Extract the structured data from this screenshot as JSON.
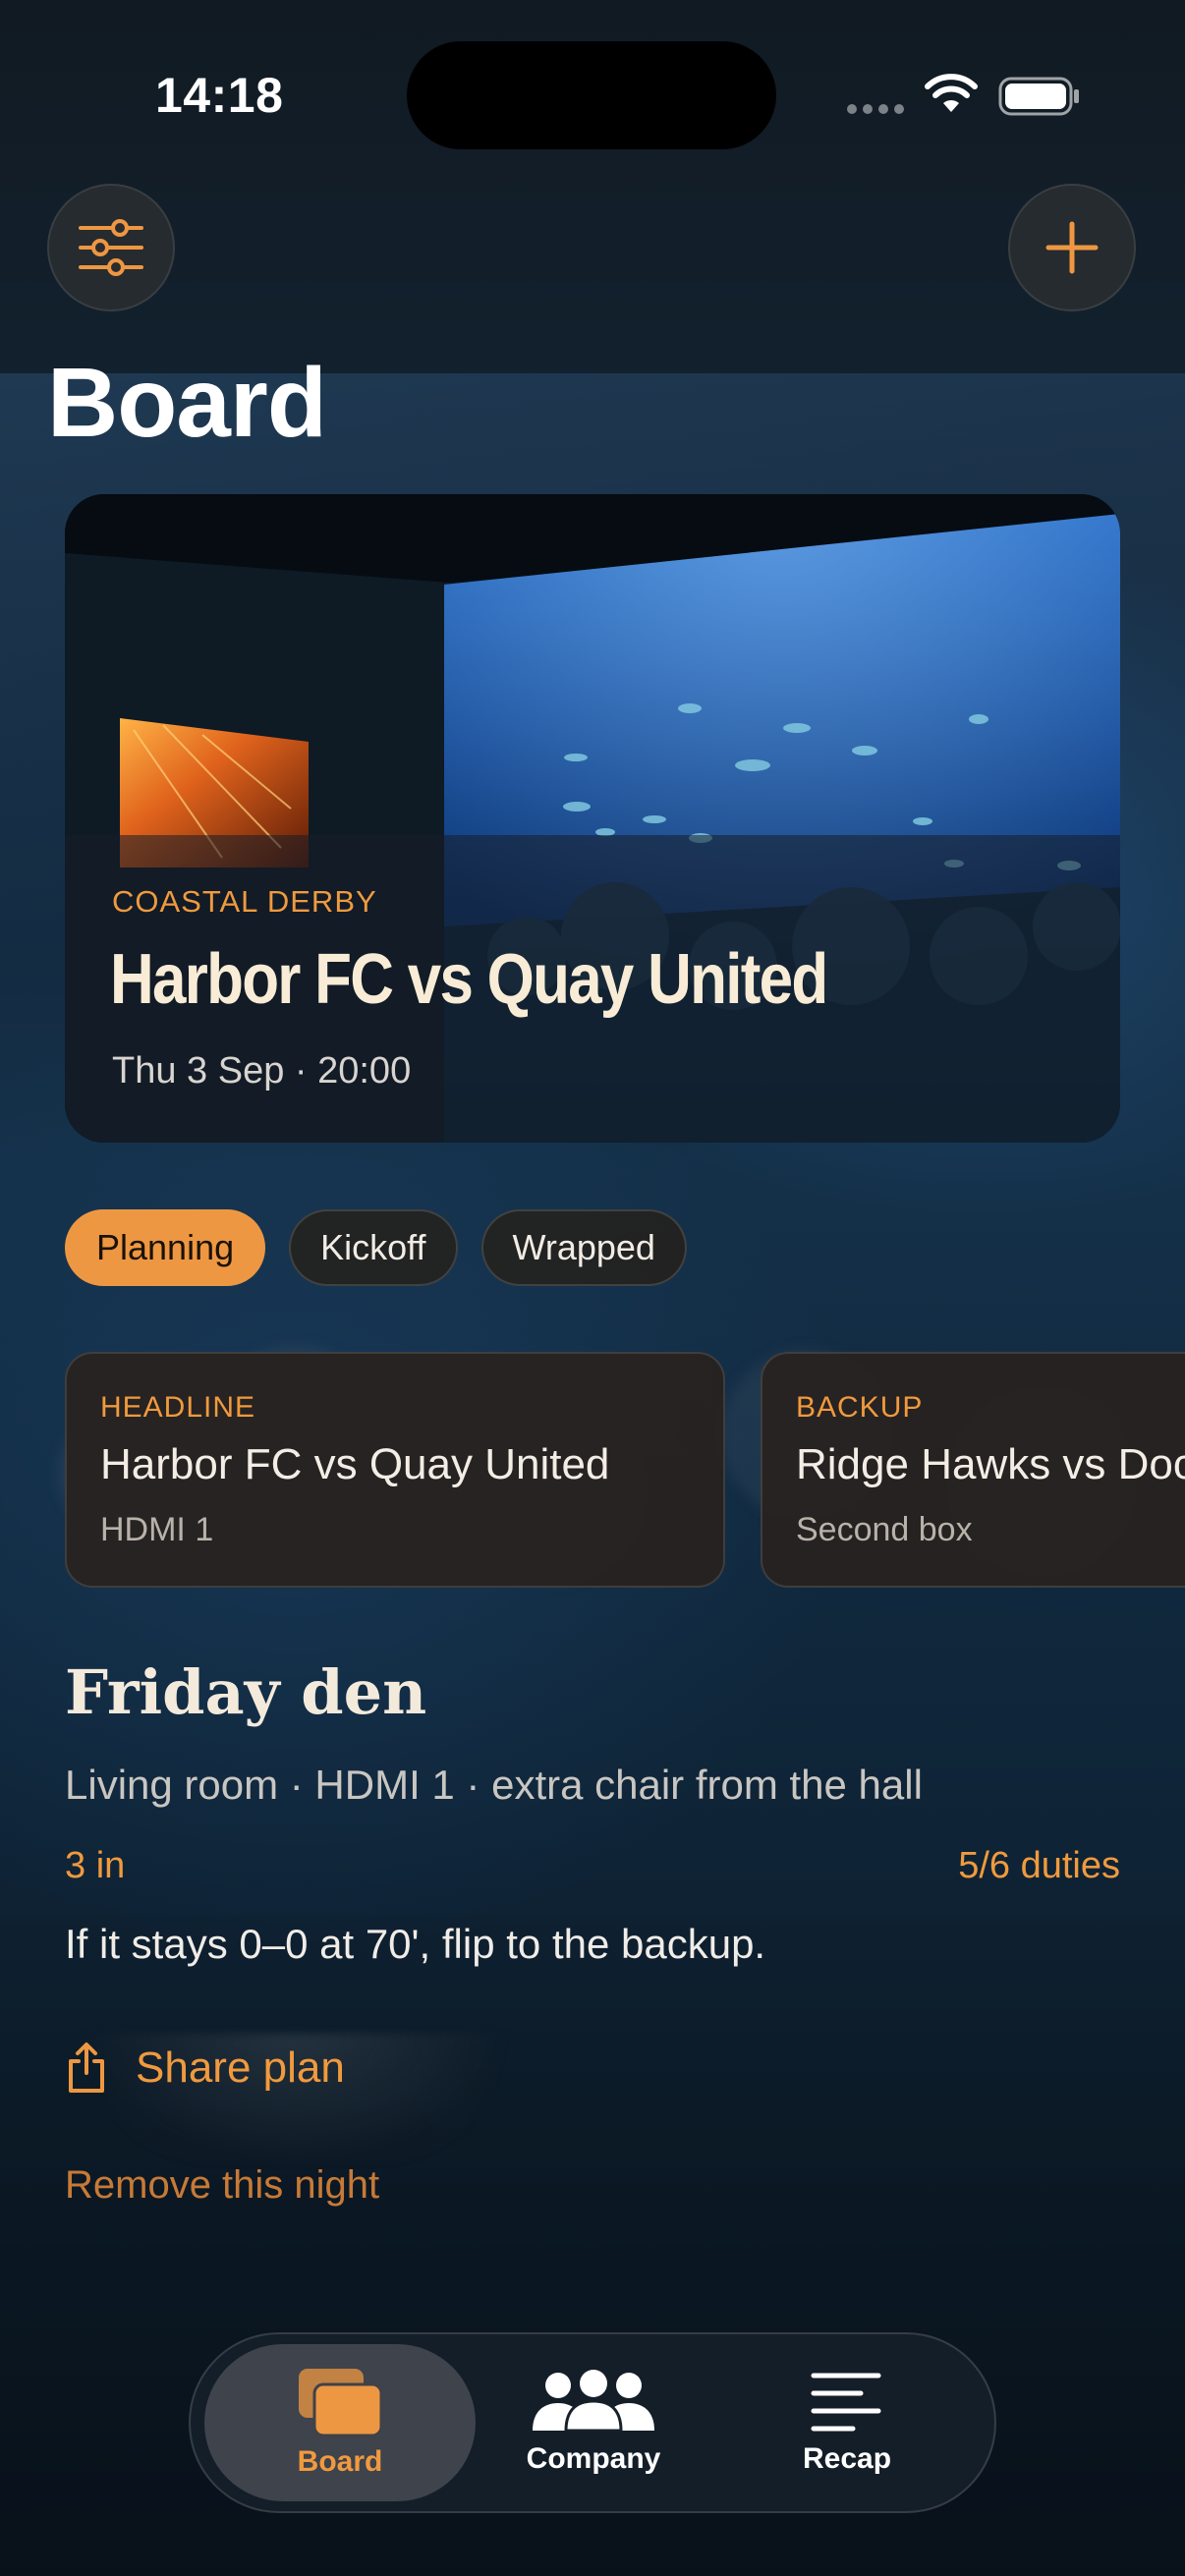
{
  "status_bar": {
    "time": "14:18"
  },
  "header": {
    "title": "Board",
    "filter_icon": "sliders-icon",
    "add_icon": "plus-icon"
  },
  "hero": {
    "eyebrow": "COASTAL DERBY",
    "title": "Harbor FC vs Quay United",
    "date": "Thu 3 Sep · 20:00"
  },
  "phases": {
    "items": [
      {
        "label": "Planning",
        "active": true
      },
      {
        "label": "Kickoff",
        "active": false
      },
      {
        "label": "Wrapped",
        "active": false
      }
    ]
  },
  "streams": [
    {
      "eyebrow": "HEADLINE",
      "title": "Harbor FC vs Quay United",
      "sub": "HDMI 1"
    },
    {
      "eyebrow": "BACKUP",
      "title": "Ridge Hawks vs Dockside",
      "sub": "Second box"
    }
  ],
  "plan": {
    "title": "Friday den",
    "meta": "Living room · HDMI 1 · extra chair from the hall",
    "attendance": "3 in",
    "duties": "5/6 duties",
    "note": "If it stays 0–0 at 70', flip to the backup.",
    "share_label": "Share plan",
    "remove_label": "Remove this night"
  },
  "tab_bar": {
    "tabs": [
      {
        "label": "Board",
        "icon": "cards-icon",
        "active": true
      },
      {
        "label": "Company",
        "icon": "people-icon",
        "active": false
      },
      {
        "label": "Recap",
        "icon": "lines-icon",
        "active": false
      }
    ]
  },
  "colors": {
    "accent": "#EE9742",
    "card": "#282220",
    "text_primary": "#F4EADB"
  }
}
